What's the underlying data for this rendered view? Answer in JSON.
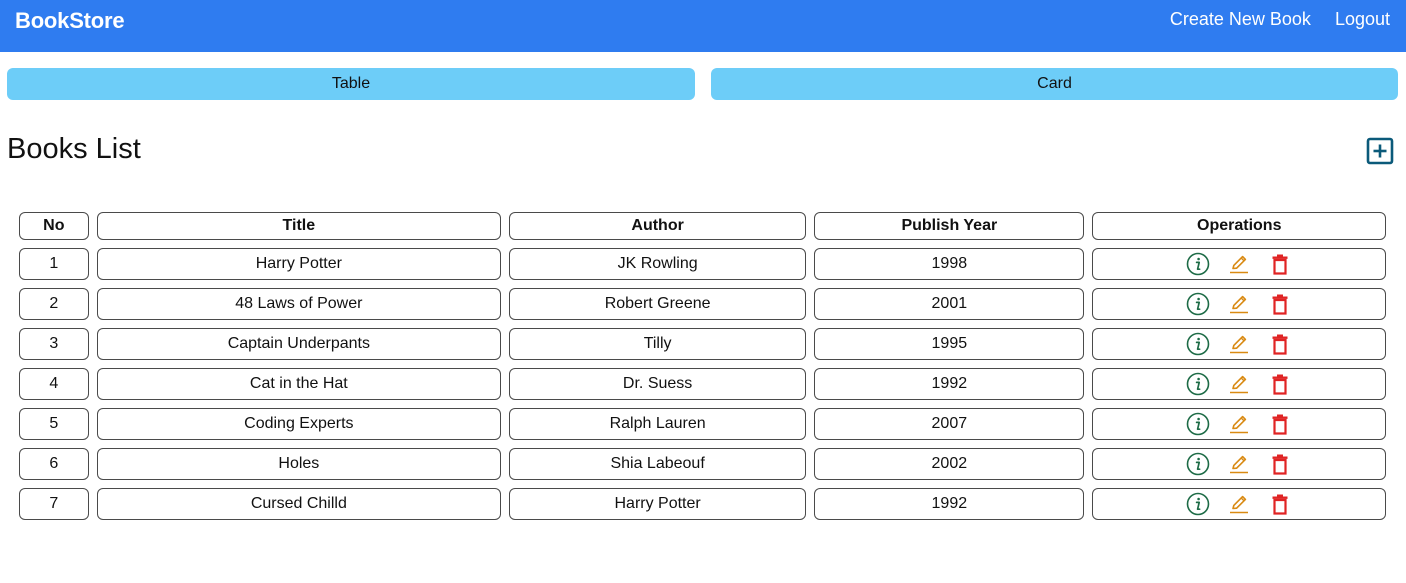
{
  "navbar": {
    "brand": "BookStore",
    "links": [
      {
        "label": "Create New Book"
      },
      {
        "label": "Logout"
      }
    ],
    "color": "#2f7cf0"
  },
  "view_toggle": {
    "table_label": "Table",
    "card_label": "Card",
    "color": "#6dcdf8"
  },
  "main": {
    "title": "Books List",
    "add_icon": "plus-box-icon",
    "add_icon_color": "#0b5a7a"
  },
  "table": {
    "headers": [
      "No",
      "Title",
      "Author",
      "Publish Year",
      "Operations"
    ],
    "rows": [
      {
        "no": "1",
        "title": "Harry Potter",
        "author": "JK Rowling",
        "year": "1998"
      },
      {
        "no": "2",
        "title": "48 Laws of Power",
        "author": "Robert Greene",
        "year": "2001"
      },
      {
        "no": "3",
        "title": "Captain Underpants",
        "author": "Tilly",
        "year": "1995"
      },
      {
        "no": "4",
        "title": "Cat in the Hat",
        "author": "Dr. Suess",
        "year": "1992"
      },
      {
        "no": "5",
        "title": "Coding Experts",
        "author": "Ralph Lauren",
        "year": "2007"
      },
      {
        "no": "6",
        "title": "Holes",
        "author": "Shia Labeouf",
        "year": "2002"
      },
      {
        "no": "7",
        "title": "Cursed Chilld",
        "author": "Harry Potter",
        "year": "1992"
      }
    ],
    "operation_icons": [
      {
        "name": "info-circle-icon",
        "color": "#1d6b46"
      },
      {
        "name": "pencil-edit-icon",
        "color": "#d98a12"
      },
      {
        "name": "trash-delete-icon",
        "color": "#e02424"
      }
    ]
  }
}
